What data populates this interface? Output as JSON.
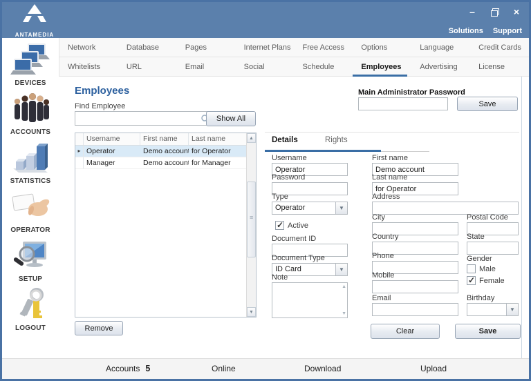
{
  "titlebar": {
    "brand": "ANTAMEDIA",
    "minimize_glyph": "–",
    "close_glyph": "×",
    "links": {
      "solutions": "Solutions",
      "support": "Support"
    }
  },
  "sidebar": {
    "items": [
      {
        "label": "DEVICES",
        "icon": "devices-icon"
      },
      {
        "label": "ACCOUNTS",
        "icon": "accounts-icon"
      },
      {
        "label": "STATISTICS",
        "icon": "statistics-icon"
      },
      {
        "label": "OPERATOR",
        "icon": "operator-icon"
      },
      {
        "label": "SETUP",
        "icon": "setup-icon"
      },
      {
        "label": "LOGOUT",
        "icon": "logout-icon"
      }
    ]
  },
  "tabs": {
    "row1": [
      "Network",
      "Database",
      "Pages",
      "Internet Plans",
      "Free Access",
      "Options",
      "Language",
      "Credit Cards"
    ],
    "row2": [
      "Whitelists",
      "URL",
      "Email",
      "Social",
      "Schedule",
      "Employees",
      "Advertising",
      "License"
    ],
    "active": "Employees"
  },
  "page": {
    "title": "Employees",
    "find_label": "Find Employee",
    "find_value": "",
    "show_all_button": "Show All",
    "admin_password_label": "Main Administrator Password",
    "admin_password_value": "",
    "admin_save_button": "Save",
    "remove_button": "Remove",
    "clear_button": "Clear",
    "save_button": "Save"
  },
  "employee_table": {
    "columns": [
      "Username",
      "First name",
      "Last name"
    ],
    "selected_marker": "▸",
    "rows": [
      {
        "username": "Operator",
        "first_name": "Demo account",
        "last_name": "for Operator",
        "selected": true
      },
      {
        "username": "Manager",
        "first_name": "Demo account",
        "last_name": "for Manager",
        "selected": false
      }
    ]
  },
  "details_panel": {
    "tabs": [
      "Details",
      "Rights"
    ],
    "active": "Details"
  },
  "form": {
    "username": {
      "label": "Username",
      "value": "Operator"
    },
    "password": {
      "label": "Password",
      "value": ""
    },
    "type": {
      "label": "Type",
      "value": "Operator"
    },
    "active": {
      "label": "Active",
      "checked": true
    },
    "document_id": {
      "label": "Document ID",
      "value": ""
    },
    "document_type": {
      "label": "Document Type",
      "value": "ID Card"
    },
    "note": {
      "label": "Note",
      "value": ""
    },
    "first_name": {
      "label": "First name",
      "value": "Demo account"
    },
    "last_name": {
      "label": "Last name",
      "value": "for Operator"
    },
    "address": {
      "label": "Address",
      "value": ""
    },
    "city": {
      "label": "City",
      "value": ""
    },
    "postal_code": {
      "label": "Postal Code",
      "value": ""
    },
    "country": {
      "label": "Country",
      "value": ""
    },
    "state": {
      "label": "State",
      "value": ""
    },
    "phone": {
      "label": "Phone",
      "value": ""
    },
    "mobile": {
      "label": "Mobile",
      "value": ""
    },
    "email": {
      "label": "Email",
      "value": ""
    },
    "gender": {
      "label": "Gender",
      "male_label": "Male",
      "female_label": "Female",
      "male_checked": false,
      "female_checked": true
    },
    "birthday": {
      "label": "Birthday",
      "value": ""
    }
  },
  "statusbar": {
    "accounts_label": "Accounts",
    "accounts_value": "5",
    "online": "Online",
    "download": "Download",
    "upload": "Upload"
  },
  "colors": {
    "titlebar": "#5b80ac",
    "window_border": "#4a72a4",
    "accent_underline": "#3a6ea5",
    "heading_text": "#2b5f9e",
    "selected_row": "#d9eaf7"
  }
}
